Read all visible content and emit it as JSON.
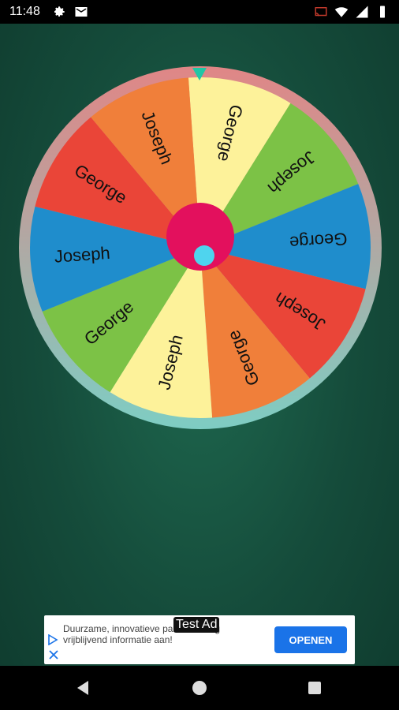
{
  "status_bar": {
    "time": "11:48",
    "left_icons": [
      "gear-icon",
      "mail-icon"
    ],
    "right_icons": [
      "cast-icon",
      "wifi-icon",
      "signal-icon",
      "battery-icon"
    ]
  },
  "wheel": {
    "segments": [
      {
        "name": "George",
        "color": "#fdf29a"
      },
      {
        "name": "Joseph",
        "color": "#7cc246"
      },
      {
        "name": "George",
        "color": "#1f8dcc"
      },
      {
        "name": "Joseph",
        "color": "#ea4538"
      },
      {
        "name": "George",
        "color": "#f07f3a"
      },
      {
        "name": "Joseph",
        "color": "#fdf29a"
      },
      {
        "name": "George",
        "color": "#7cc246"
      },
      {
        "name": "Joseph",
        "color": "#1f8dcc"
      },
      {
        "name": "George",
        "color": "#ea4538"
      },
      {
        "name": "Joseph",
        "color": "#f07f3a"
      }
    ],
    "pointer_color": "#1fc7a6",
    "hub_color": "#e3105d",
    "hub_dot_color": "#4fd4ee",
    "rim_colors": [
      "#e08686",
      "#7ecdc3"
    ]
  },
  "ad": {
    "label": "Test Ad",
    "text": "Duurzame, innovatieve pallets. Vraag vrijblijvend informatie aan!",
    "button": "OPENEN"
  },
  "nav": {
    "buttons": [
      "back-icon",
      "home-icon",
      "recents-icon"
    ]
  }
}
